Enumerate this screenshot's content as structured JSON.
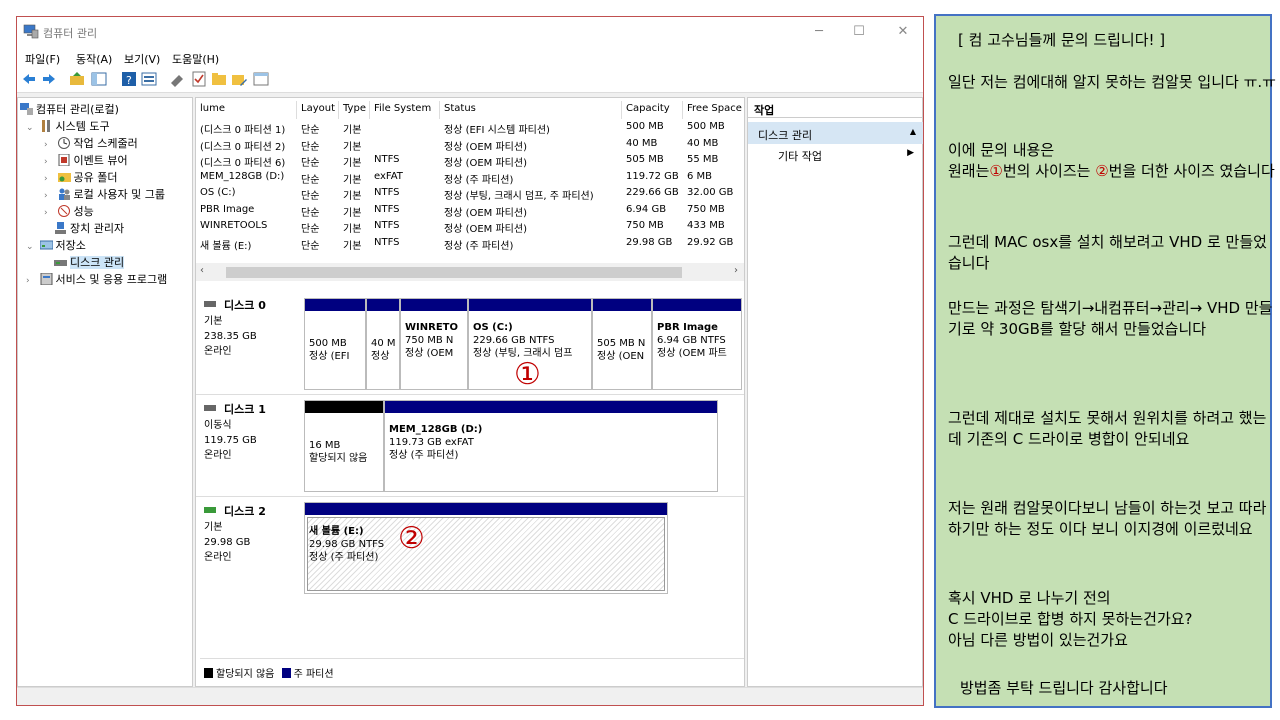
{
  "window": {
    "title": "컴퓨터 관리",
    "controls": {
      "minimize": "─",
      "maximize": "☐",
      "close": "✕"
    }
  },
  "menu": [
    "파일(F)",
    "동작(A)",
    "보기(V)",
    "도움말(H)"
  ],
  "tree": {
    "items": [
      {
        "label": "컴퓨터 관리(로컬)",
        "arrow": ""
      },
      {
        "label": "시스템 도구",
        "arrow": "⌄"
      },
      {
        "label": "작업 스케줄러",
        "arrow": "›"
      },
      {
        "label": "이벤트 뷰어",
        "arrow": "›"
      },
      {
        "label": "공유 폴더",
        "arrow": "›"
      },
      {
        "label": "로컬 사용자 및 그룹",
        "arrow": "›"
      },
      {
        "label": "성능",
        "arrow": "›"
      },
      {
        "label": "장치 관리자",
        "arrow": ""
      },
      {
        "label": "저장소",
        "arrow": "⌄"
      },
      {
        "label": "디스크 관리",
        "arrow": ""
      },
      {
        "label": "서비스 및 응용 프로그램",
        "arrow": "›"
      }
    ]
  },
  "volumes": {
    "columns": [
      "lume",
      "Layout",
      "Type",
      "File System",
      "Status",
      "Capacity",
      "Free Space"
    ],
    "rows": [
      [
        "(디스크 0 파티션 1)",
        "단순",
        "기본",
        "",
        "정상 (EFI 시스템 파티션)",
        "500 MB",
        "500 MB"
      ],
      [
        "(디스크 0 파티션 2)",
        "단순",
        "기본",
        "",
        "정상 (OEM 파티션)",
        "40 MB",
        "40 MB"
      ],
      [
        "(디스크 0 파티션 6)",
        "단순",
        "기본",
        "NTFS",
        "정상 (OEM 파티션)",
        "505 MB",
        "55 MB"
      ],
      [
        "MEM_128GB (D:)",
        "단순",
        "기본",
        "exFAT",
        "정상 (주 파티션)",
        "119.72 GB",
        "6 MB"
      ],
      [
        "OS (C:)",
        "단순",
        "기본",
        "NTFS",
        "정상 (부팅, 크래시 덤프, 주 파티션)",
        "229.66 GB",
        "32.00 GB"
      ],
      [
        "PBR Image",
        "단순",
        "기본",
        "NTFS",
        "정상 (OEM 파티션)",
        "6.94 GB",
        "750 MB"
      ],
      [
        "WINRETOOLS",
        "단순",
        "기본",
        "NTFS",
        "정상 (OEM 파티션)",
        "750 MB",
        "433 MB"
      ],
      [
        "새 볼륨 (E:)",
        "단순",
        "기본",
        "NTFS",
        "정상 (주 파티션)",
        "29.98 GB",
        "29.92 GB"
      ]
    ],
    "scroll_left": "‹",
    "scroll_right": "›"
  },
  "disks": [
    {
      "name": "디스크 0",
      "type": "기본",
      "size": "238.35 GB",
      "state": "온라인",
      "partitions": [
        {
          "name": "",
          "size": "500 MB",
          "status": "정상 (EFI"
        },
        {
          "name": "",
          "size": "40 M",
          "status": "정상"
        },
        {
          "name": "WINRETO",
          "size": "750 MB N",
          "status": "정상 (OEM"
        },
        {
          "name": "OS  (C:)",
          "size": "229.66 GB NTFS",
          "status": "정상 (부팅, 크래시 덤프"
        },
        {
          "name": "",
          "size": "505 MB N",
          "status": "정상 (OEN"
        },
        {
          "name": "PBR Image",
          "size": "6.94 GB NTFS",
          "status": "정상 (OEM 파트"
        }
      ]
    },
    {
      "name": "디스크 1",
      "type": "이동식",
      "size": "119.75 GB",
      "state": "온라인",
      "partitions": [
        {
          "name": "",
          "size": "16 MB",
          "status": "할당되지 않음"
        },
        {
          "name": "MEM_128GB  (D:)",
          "size": "119.73 GB exFAT",
          "status": "정상 (주 파티션)"
        }
      ]
    },
    {
      "name": "디스크 2",
      "type": "기본",
      "size": "29.98 GB",
      "state": "온라인",
      "partitions": [
        {
          "name": "새 볼륨  (E:)",
          "size": "29.98 GB NTFS",
          "status": "정상 (주 파티션)"
        }
      ]
    }
  ],
  "markers": {
    "one": "①",
    "two": "②"
  },
  "legend": {
    "unallocated": "할당되지 않음",
    "primary": "주 파티션"
  },
  "actions": {
    "header": "작업",
    "section": "디스크 관리",
    "section_arrow": "▲",
    "item": "기타 작업",
    "item_arrow": "▶"
  },
  "note": {
    "title": "[ 컴 고수님들께 문의 드립니다! ]",
    "p1": "일단 저는 컴에대해 알지 못하는 컴알못 입니다 ㅠ.ㅠ",
    "p2_a": "이에 문의 내용은",
    "p2_b": "원래는",
    "p2_c": "번의 사이즈는 ",
    "p2_d": "번을 더한 사이즈 였습니다",
    "p3": "그런데 MAC osx를 설치 해보려고 VHD 로 만들었습니다",
    "p4": "만드는 과정은 탐색기→내컴퓨터→관리→ VHD 만들기로 약 30GB를 할당 해서 만들었습니다",
    "p5": "그런데 제대로 설치도 못해서 원위치를 하려고 했는데 기존의 C 드라이로 병합이 안되네요",
    "p6": "저는 원래 컴알못이다보니 남들이 하는것 보고 따라 하기만 하는 정도 이다 보니 이지경에 이르렀네요",
    "p7_a": "혹시 VHD 로 나누기 전의",
    "p7_b": "C 드라이브로 합병 하지 못하는건가요?",
    "p7_c": "아님 다른 방법이 있는건가요",
    "p8": "방법좀 부탁 드립니다 감사합니다"
  },
  "colors": {
    "primary_partition": "#000080",
    "unallocated": "#000000",
    "marker": "#c00000",
    "note_bg": "#c5e0b4",
    "note_border": "#4472c4"
  }
}
